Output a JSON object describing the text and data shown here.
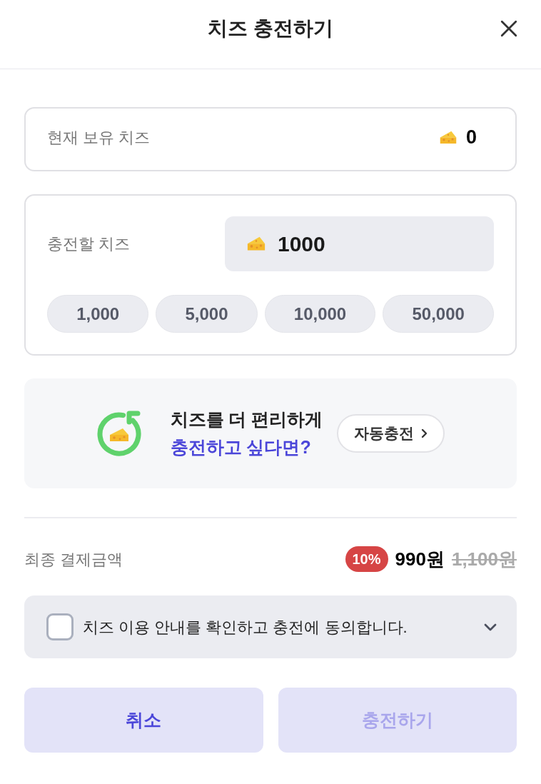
{
  "header": {
    "title": "치즈 충전하기"
  },
  "balance": {
    "label": "현재 보유 치즈",
    "value": "0"
  },
  "charge": {
    "label": "충전할 치즈",
    "amount": "1000",
    "presets": [
      "1,000",
      "5,000",
      "10,000",
      "50,000"
    ]
  },
  "auto_charge_banner": {
    "line_1": "치즈를 더 편리하게",
    "line_2": "충전하고 싶다면?",
    "button": "자동충전"
  },
  "payment": {
    "label": "최종 결제금액",
    "discount": "10%",
    "price": "990원",
    "original_price": "1,100원"
  },
  "agreement": {
    "text": "치즈 이용 안내를 확인하고 충전에 동의합니다.",
    "checked": false,
    "expanded": false
  },
  "buttons": [
    {
      "label": "취소",
      "kind": "cancel",
      "disabled": false
    },
    {
      "label": "충전하기",
      "kind": "confirm",
      "disabled": true
    }
  ]
}
